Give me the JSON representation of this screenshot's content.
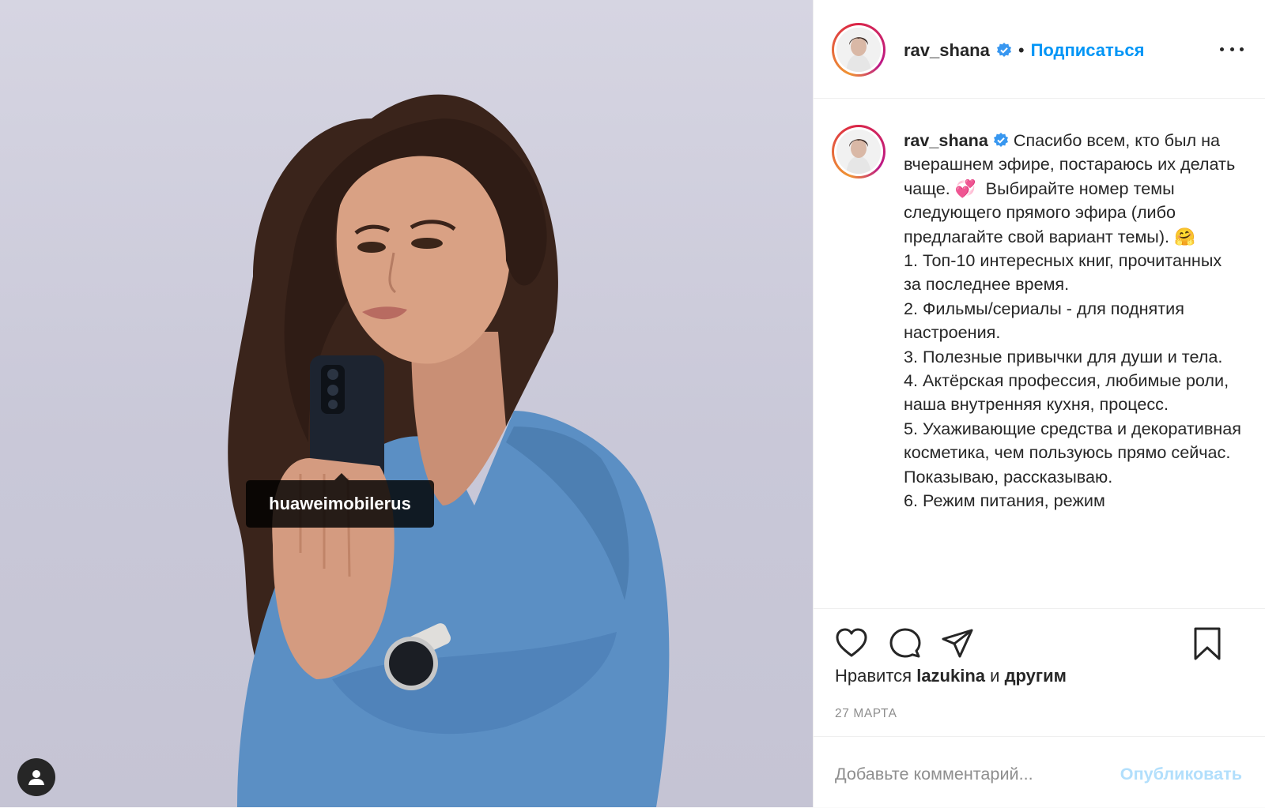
{
  "post": {
    "media": {
      "tag_label": "huaweimobilerus",
      "tag_user_icon": "person-icon"
    },
    "header": {
      "username": "rav_shana",
      "verified_icon": "verified-badge-icon",
      "separator": "•",
      "follow_label": "Подписаться",
      "more_icon": "more-options-icon"
    },
    "caption": {
      "username": "rav_shana",
      "text": "Спасибо всем, кто был на вчерашнем эфире, постараюсь их делать чаще. 💞  Выбирайте номер темы следующего прямого эфира (либо предлагайте свой вариант темы). 🤗\n1. Топ-10 интересных книг, прочитанных за последнее время.\n2. Фильмы/сериалы - для поднятия настроения.\n3. Полезные привычки для души и тела.\n4. Актёрская профессия, любимые роли, наша внутренняя кухня, процесс.\n5. Ухаживающие средства и декоративная косметика, чем пользуюсь прямо сейчас. Показываю, рассказываю.\n6. Режим питания, режим"
    },
    "actions": {
      "like_icon": "heart-icon",
      "comment_icon": "comment-icon",
      "share_icon": "share-icon",
      "save_icon": "bookmark-icon"
    },
    "likes": {
      "prefix": "Нравится",
      "user": "lazukina",
      "joiner": "и",
      "others": "другим"
    },
    "date": "27 МАРТА",
    "comment": {
      "placeholder": "Добавьте комментарий...",
      "value": "",
      "publish_label": "Опубликовать"
    },
    "colors": {
      "link": "#0095f6",
      "publish_disabled": "#b2dffc",
      "muted": "#8e8e8e",
      "photo_bg": "#c9c8d8"
    }
  }
}
